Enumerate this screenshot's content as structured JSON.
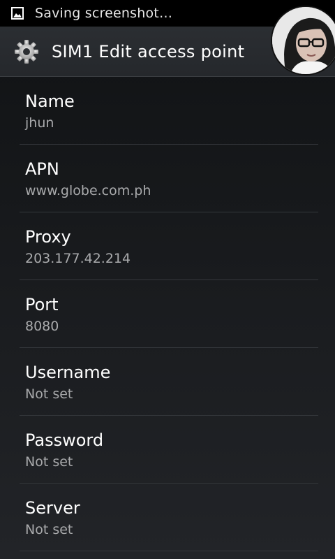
{
  "status_bar": {
    "notification_icon": "image-icon",
    "text": "Saving screenshot…"
  },
  "action_bar": {
    "icon": "gear-icon",
    "title": "SIM1 Edit access point",
    "avatar": "avatar-photo"
  },
  "fields": [
    {
      "label": "Name",
      "value": "jhun"
    },
    {
      "label": "APN",
      "value": "www.globe.com.ph"
    },
    {
      "label": "Proxy",
      "value": "203.177.42.214"
    },
    {
      "label": "Port",
      "value": "8080"
    },
    {
      "label": "Username",
      "value": "Not set"
    },
    {
      "label": "Password",
      "value": "Not set"
    },
    {
      "label": "Server",
      "value": "Not set"
    }
  ],
  "colors": {
    "status_bar_bg": "#000000",
    "action_bar_bg": "#2b2e32",
    "label": "#ffffff",
    "value": "#a9aaac",
    "divider": "#34373b"
  }
}
